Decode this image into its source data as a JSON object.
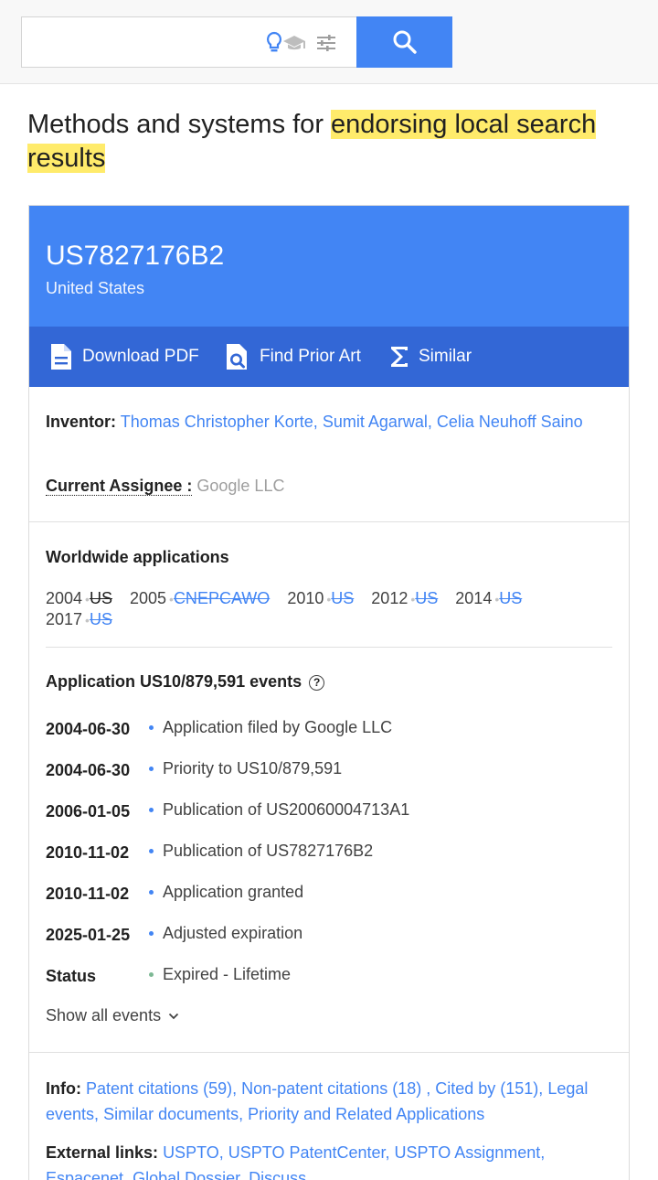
{
  "search": {
    "placeholder": "",
    "value": ""
  },
  "icons": {
    "idea": "lightbulb-icon",
    "scholar": "graduation-cap-icon",
    "filter": "tune-icon",
    "search": "magnifier-icon"
  },
  "colors": {
    "brand_blue": "#4285f4",
    "brand_dark_blue": "#3367d6",
    "highlight": "#ffeb6b",
    "link": "#4285f4"
  },
  "title": {
    "prefix": "Methods and systems for ",
    "highlight": "endorsing local search results"
  },
  "patent": {
    "number": "US7827176B2",
    "country": "United States"
  },
  "actions": {
    "download": "Download PDF",
    "prior_art": "Find Prior Art",
    "similar": "Similar"
  },
  "inventor": {
    "label": "Inventor:",
    "names": [
      "Thomas Christopher Korte",
      "Sumit Agarwal",
      "Celia Neuhoff Saino"
    ],
    "sep": ", "
  },
  "assignee": {
    "label": "Current Assignee :",
    "value": "Google LLC"
  },
  "worldwide": {
    "heading": "Worldwide applications",
    "row1": [
      {
        "year": "2004",
        "codes": [
          "US"
        ],
        "dark": true
      },
      {
        "year": "2005",
        "codes": [
          "CN",
          "EP",
          "CA",
          "WO"
        ]
      },
      {
        "year": "2010",
        "codes": [
          "US"
        ]
      },
      {
        "year": "2012",
        "codes": [
          "US"
        ]
      },
      {
        "year": "2014",
        "codes": [
          "US"
        ]
      }
    ],
    "row2": [
      {
        "year": "2017",
        "codes": [
          "US"
        ]
      }
    ]
  },
  "events": {
    "heading": "Application US10/879,591 events",
    "help": "?",
    "items": [
      {
        "date": "2004-06-30",
        "text": "Application filed by Google LLC"
      },
      {
        "date": "2004-06-30",
        "text": "Priority to US10/879,591"
      },
      {
        "date": "2006-01-05",
        "text": "Publication of US20060004713A1"
      },
      {
        "date": "2010-11-02",
        "text": "Publication of US7827176B2"
      },
      {
        "date": "2010-11-02",
        "text": "Application granted"
      },
      {
        "date": "2025-01-25",
        "text": "Adjusted expiration"
      }
    ],
    "status": {
      "label": "Status",
      "text": "Expired - Lifetime"
    },
    "show_all": "Show all events"
  },
  "info": {
    "label": "Info:",
    "links": [
      "Patent citations (59)",
      "Non-patent citations (18) ",
      "Cited by (151)",
      "Legal events",
      "Similar documents",
      "Priority and Related Applications"
    ]
  },
  "external": {
    "label": "External links:",
    "links": [
      "USPTO",
      "USPTO PatentCenter",
      "USPTO Assignment",
      "Espacenet",
      "Global Dossier",
      "Discuss"
    ]
  }
}
